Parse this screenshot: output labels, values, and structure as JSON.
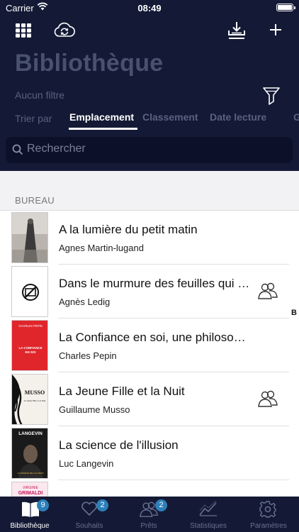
{
  "status_bar": {
    "carrier": "Carrier",
    "time": "08:49"
  },
  "header": {
    "title": "Bibliothèque",
    "filter": "Aucun filtre",
    "sort_label": "Trier par",
    "tabs": [
      "Emplacement",
      "Classement",
      "Date lecture",
      "G"
    ],
    "active_tab": "Emplacement"
  },
  "search": {
    "placeholder": "Rechercher"
  },
  "section": {
    "title": "BUREAU"
  },
  "books": [
    {
      "title": "A la lumière du petit matin",
      "author": "Agnes Martin-lugand",
      "status_icon": ""
    },
    {
      "title": "Dans le murmure des feuilles qui d…",
      "author": "Agnès Ledig",
      "status_icon": "people-icon"
    },
    {
      "title": "La Confiance en soi, une philosophie",
      "author": "Charles Pepin",
      "status_icon": ""
    },
    {
      "title": "La Jeune Fille et la Nuit",
      "author": "Guillaume Musso",
      "status_icon": "people-icon"
    },
    {
      "title": "La science de l'illusion",
      "author": "Luc Langevin",
      "status_icon": ""
    }
  ],
  "covers": {
    "confiance": {
      "line1": "CHARLES PEPIN",
      "line2": "LA CONFIANCE",
      "line3": "EN SOI"
    },
    "musso": {
      "line1": "MUSSO",
      "line2": "La Jeune Fille et la Nuit"
    },
    "langevin": {
      "line1": "LANGEVIN",
      "line2": "LA SCIENCE DE L'ILLUSION"
    },
    "grimaldi": {
      "line1": "VIRGINIE",
      "line2": "GRIMALDI"
    }
  },
  "index_letter": "B",
  "tabbar": [
    {
      "label": "Bibliothèque",
      "badge": "9",
      "icon": "book-icon"
    },
    {
      "label": "Souhaits",
      "badge": "2",
      "icon": "heart-icon"
    },
    {
      "label": "Prêts",
      "badge": "2",
      "icon": "people-icon"
    },
    {
      "label": "Statistiques",
      "badge": "",
      "icon": "chart-icon"
    },
    {
      "label": "Paramètres",
      "badge": "",
      "icon": "gear-icon"
    }
  ],
  "colors": {
    "header_bg": "#141a35",
    "accent": "#2d7fb9"
  }
}
